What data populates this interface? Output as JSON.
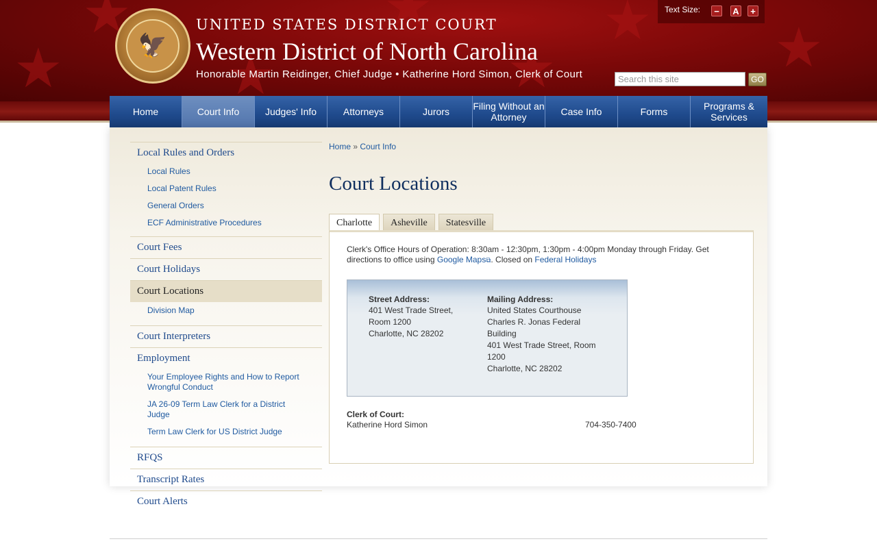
{
  "header": {
    "line1": "UNITED STATES DISTRICT COURT",
    "line2": "Western District of North Carolina",
    "line3": "Honorable Martin Reidinger, Chief Judge • Katherine Hord Simon, Clerk of Court",
    "text_size_label": "Text Size:",
    "text_size_buttons": [
      "−",
      "A",
      "+"
    ],
    "search_placeholder": "Search this site",
    "go_label": "GO"
  },
  "nav": {
    "items": [
      "Home",
      "Court Info",
      "Judges' Info",
      "Attorneys",
      "Jurors",
      "Filing Without an Attorney",
      "Case Info",
      "Forms",
      "Programs & Services"
    ],
    "active": "Court Info"
  },
  "sidebar": {
    "local_rules": "Local Rules and Orders",
    "local_rules_items": [
      "Local Rules",
      "Local Patent Rules",
      "General Orders",
      "ECF Administrative Procedures"
    ],
    "court_fees": "Court Fees",
    "court_holidays": "Court Holidays",
    "court_locations": "Court Locations",
    "court_locations_items": [
      "Division Map"
    ],
    "court_interpreters": "Court Interpreters",
    "employment": "Employment",
    "employment_items": [
      "Your Employee Rights and How to Report Wrongful Conduct",
      "JA 26-09 Term Law Clerk for a District Judge",
      "Term Law Clerk for US District Judge"
    ],
    "rfqs": "RFQS",
    "transcript_rates": "Transcript Rates",
    "court_alerts": "Court Alerts"
  },
  "breadcrumb": {
    "home": "Home",
    "sep": "»",
    "current": "Court Info"
  },
  "main": {
    "title": "Court Locations",
    "tabs": [
      "Charlotte",
      "Asheville",
      "Statesville"
    ],
    "hours_text_1": "Clerk's Office Hours of Operation: 8:30am - 12:30pm, 1:30pm - 4:00pm Monday through Friday. Get directions to office using ",
    "google_maps": "Google Maps",
    "hours_text_2": ". Closed on ",
    "federal_holidays": "Federal Holidays",
    "street_label": "Street Address:",
    "street_lines": [
      "401 West Trade Street,",
      "Room 1200",
      "Charlotte, NC  28202"
    ],
    "mailing_label": "Mailing Address:",
    "mailing_lines": [
      "United States Courthouse",
      "Charles R. Jonas Federal",
      "Building",
      "401 West Trade Street, Room",
      "1200",
      "Charlotte, NC  28202"
    ],
    "clerk_label": "Clerk of Court:",
    "clerk_name": "Katherine Hord Simon",
    "clerk_phone": "704-350-7400"
  }
}
